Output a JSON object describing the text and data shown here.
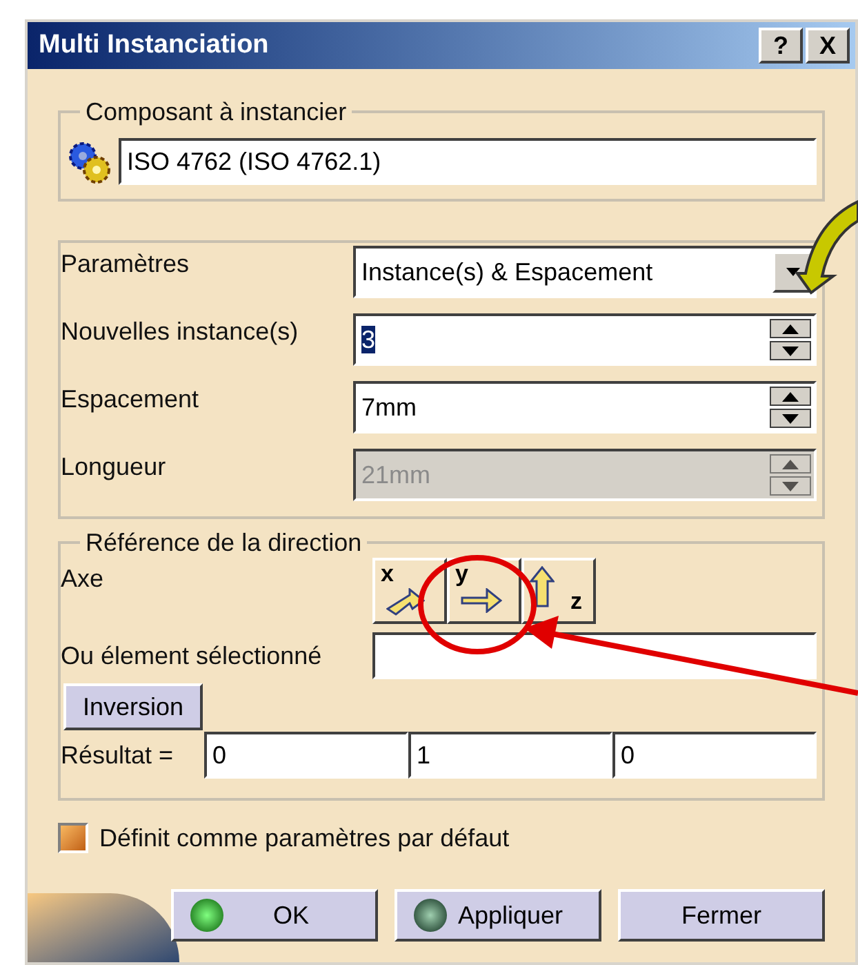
{
  "window": {
    "title": "Multi Instanciation",
    "buttons": [
      "?",
      "X"
    ]
  },
  "component": {
    "legend": "Composant à instancier",
    "value": "ISO 4762 (ISO 4762.1)"
  },
  "parameters": {
    "rows": [
      {
        "kind": "dropdown",
        "label": "Paramètres",
        "value": "Instance(s) & Espacement",
        "disabled": false
      },
      {
        "kind": "spinner",
        "label": "Nouvelles instance(s)",
        "value": "3",
        "disabled": false,
        "text_selected": true
      },
      {
        "kind": "spinner",
        "label": "Espacement",
        "value": "7mm",
        "disabled": false,
        "text_selected": false
      },
      {
        "kind": "spinner",
        "label": "Longueur",
        "value": "21mm",
        "disabled": true,
        "text_selected": false
      }
    ]
  },
  "direction": {
    "legend": "Référence de la direction",
    "axis_label": "Axe",
    "axes": [
      {
        "label": "x",
        "kind": "slant",
        "selected": false
      },
      {
        "label": "y",
        "kind": "right",
        "selected": false
      },
      {
        "label": "z",
        "kind": "up",
        "selected": false
      }
    ],
    "element_label": "Ou élement sélectionné",
    "inversion": "Inversion",
    "result_label": "Résultat =",
    "result": [
      "0",
      "1",
      "0"
    ]
  },
  "default_checkbox": {
    "label": "Définit comme paramètres par défaut",
    "checked": true
  },
  "buttons": [
    {
      "label": "OK",
      "kind": "ok"
    },
    {
      "label": "Appliquer",
      "kind": "apply"
    },
    {
      "label": "Fermer",
      "kind": "plain"
    }
  ]
}
